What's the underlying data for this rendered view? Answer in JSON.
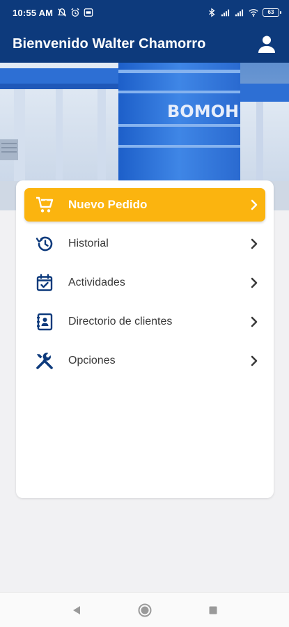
{
  "status_bar": {
    "time": "10:55 AM",
    "battery": "63",
    "icons": [
      "mute-icon",
      "alarm-icon",
      "notification-icon",
      "bluetooth-icon",
      "signal-icon",
      "signal-icon",
      "wifi-icon",
      "battery-icon"
    ]
  },
  "app_bar": {
    "title": "Bienvenido Walter Chamorro",
    "profile_icon": "person-icon"
  },
  "banner": {
    "sign_text": "BOMOHSI"
  },
  "menu": {
    "items": [
      {
        "label": "Nuevo Pedido",
        "icon": "cart-add-icon",
        "primary": true
      },
      {
        "label": "Historial",
        "icon": "history-icon",
        "primary": false
      },
      {
        "label": "Actividades",
        "icon": "calendar-check-icon",
        "primary": false
      },
      {
        "label": "Directorio de clientes",
        "icon": "contacts-icon",
        "primary": false
      },
      {
        "label": "Opciones",
        "icon": "tools-icon",
        "primary": false
      }
    ]
  },
  "nav_bar": {
    "buttons": [
      "back-icon",
      "home-icon",
      "recents-icon"
    ]
  },
  "colors": {
    "primary": "#0d3a7c",
    "accent": "#fbb40f",
    "icon": "#0d3a7c",
    "background": "#f1f1f3"
  }
}
